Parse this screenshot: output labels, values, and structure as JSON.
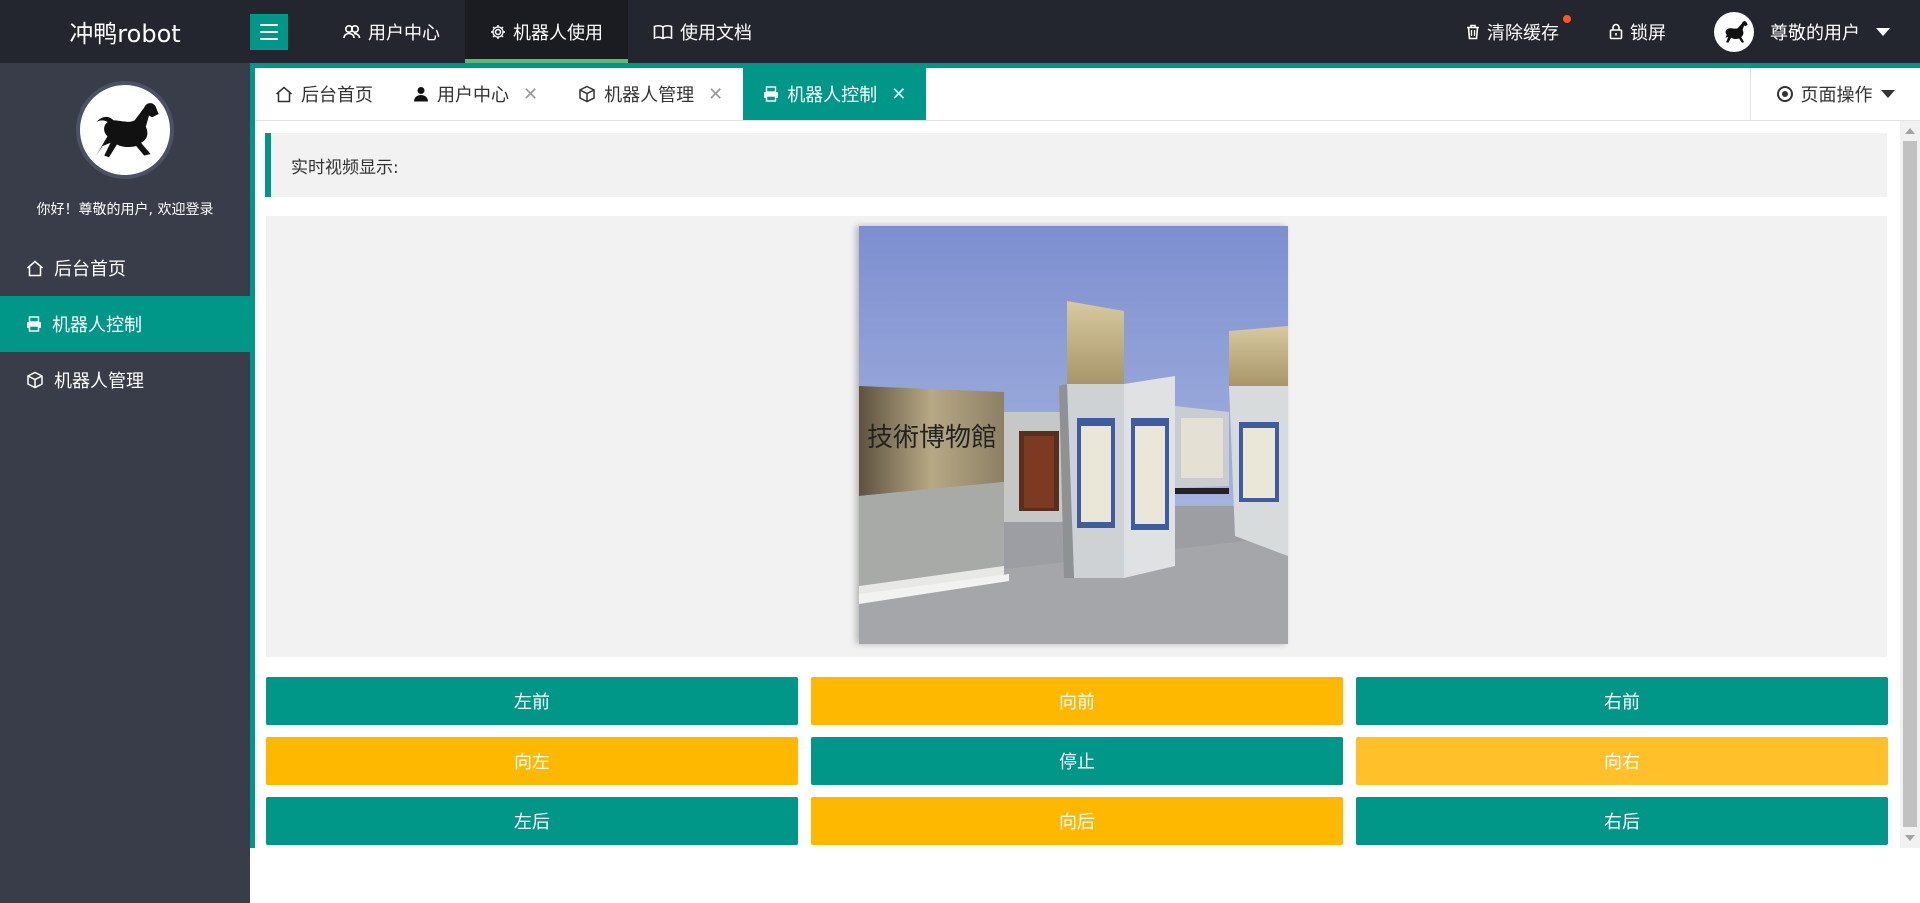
{
  "app": {
    "logo_text": "冲鸭robot"
  },
  "top_nav": {
    "items": [
      {
        "label": "用户中心",
        "icon": "users-icon"
      },
      {
        "label": "机器人使用",
        "icon": "gear-icon"
      },
      {
        "label": "使用文档",
        "icon": "book-icon"
      }
    ],
    "active_index": 1
  },
  "header_right": {
    "clear_cache": "清除缓存",
    "lock_screen": "锁屏",
    "user_name": "尊敬的用户"
  },
  "sidebar": {
    "welcome": "你好！尊敬的用户, 欢迎登录",
    "items": [
      {
        "label": "后台首页",
        "icon": "home-icon"
      },
      {
        "label": "机器人控制",
        "icon": "printer-icon"
      },
      {
        "label": "机器人管理",
        "icon": "cube-icon"
      }
    ],
    "active_index": 1
  },
  "tabs": {
    "items": [
      {
        "label": "后台首页",
        "icon": "home-icon",
        "closable": false
      },
      {
        "label": "用户中心",
        "icon": "user-icon",
        "closable": true
      },
      {
        "label": "机器人管理",
        "icon": "cube-icon",
        "closable": true
      },
      {
        "label": "机器人控制",
        "icon": "printer-icon",
        "closable": true
      }
    ],
    "active_index": 3,
    "page_ops": "页面操作"
  },
  "main": {
    "video_label": "实时视频显示:"
  },
  "controls": {
    "forward_left": "左前",
    "forward": "向前",
    "forward_right": "右前",
    "left": "向左",
    "stop": "停止",
    "right": "向右",
    "back_left": "左后",
    "back": "向后",
    "back_right": "右后"
  },
  "colors": {
    "primary": "#009688",
    "warning": "#ffb800",
    "header_bg": "#23262e",
    "sidebar_bg": "#393d49"
  }
}
